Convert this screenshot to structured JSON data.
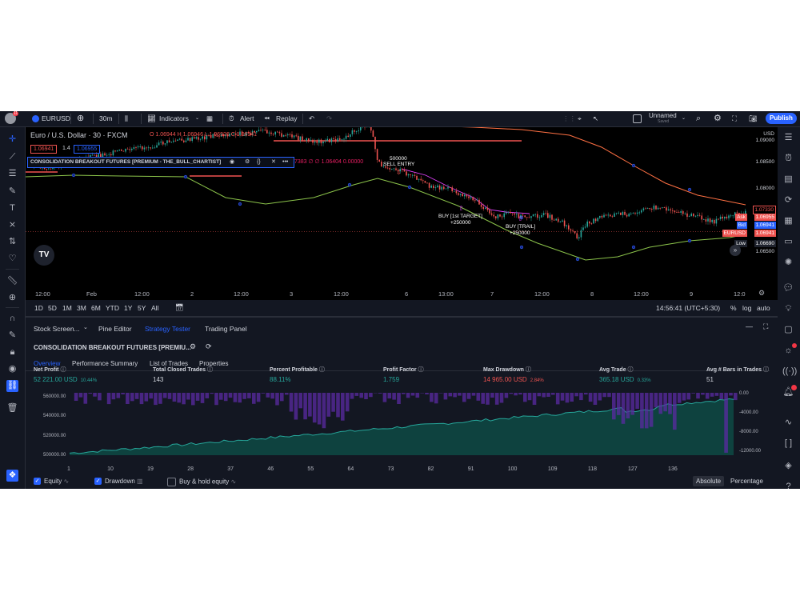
{
  "toolbar": {
    "symbol": "EURUSD",
    "interval": "30m",
    "indicators": "Indicators",
    "alert": "Alert",
    "replay": "Replay",
    "layout_name": "Unnamed",
    "layout_status": "Saved",
    "publish": "Publish",
    "avatar_badge": "11"
  },
  "legend": {
    "title": "Euro / U.S. Dollar · 30 · FXCM",
    "ohlc_o": "O 1.06944",
    "ohlc_h": "H 1.06946",
    "ohlc_l": "L 1.06926",
    "ohlc_c": "C 1.06941",
    "bid": "1.06941",
    "spread": "1.4",
    "ask": "1.06955",
    "strategy_name": "CONSOLIDATION BREAKOUT FUTURES [PREMIUM - THE_BULL_CHARTIST]",
    "strategy_values": "7383 ∅ ∅ 1.06404 0.00000"
  },
  "annotations": {
    "sell_qty": "500000",
    "sell_label": "SELL ENTRY",
    "buy1_label": "BUY [1st TARGET]",
    "buy1_qty": "+250000",
    "buy2_label": "BUY [TRAIL]",
    "buy2_qty": "+250000"
  },
  "price_scale": {
    "currency": "USD",
    "levels": [
      "1.09000",
      "1.08500",
      "1.08000",
      "1.07500",
      "1.07000",
      "1.06500"
    ],
    "tag_red_price": "1.07330",
    "ask_label": "Ask",
    "ask_price": "1.06955",
    "bid_label": "Bid",
    "bid_price": "1.06941",
    "sym_label": "EURUSD",
    "sym_price": "1.06941",
    "low_label": "Low",
    "low_price": "1.06690"
  },
  "time_scale": [
    "12:00",
    "Feb",
    "12:00",
    "2",
    "12:00",
    "3",
    "12:00",
    "6",
    "13:00",
    "7",
    "12:00",
    "8",
    "12:00",
    "9",
    "12:0"
  ],
  "ranges": [
    "1D",
    "5D",
    "1M",
    "3M",
    "6M",
    "YTD",
    "1Y",
    "5Y",
    "All"
  ],
  "range_bar": {
    "clock": "14:56:41 (UTC+5:30)",
    "pct": "%",
    "log": "log",
    "auto": "auto"
  },
  "panel_tabs": [
    "Stock Screen...",
    "Pine Editor",
    "Strategy Tester",
    "Trading Panel"
  ],
  "strategy_short": "CONSOLIDATION BREAKOUT FUTURES [PREMIU...",
  "sub_tabs": [
    "Overview",
    "Performance Summary",
    "List of Trades",
    "Properties"
  ],
  "stats": [
    {
      "label": "Net Profit",
      "value": "52 221.00 USD",
      "extra": "10.44%",
      "color": "#26a69a"
    },
    {
      "label": "Total Closed Trades",
      "value": "143",
      "extra": "",
      "color": "#d1d4dc"
    },
    {
      "label": "Percent Profitable",
      "value": "88.11%",
      "extra": "",
      "color": "#26a69a"
    },
    {
      "label": "Profit Factor",
      "value": "1.759",
      "extra": "",
      "color": "#26a69a"
    },
    {
      "label": "Max Drawdown",
      "value": "14 965.00 USD",
      "extra": "2.84%",
      "color": "#ef5350"
    },
    {
      "label": "Avg Trade",
      "value": "365.18 USD",
      "extra": "0.33%",
      "color": "#26a69a"
    },
    {
      "label": "Avg # Bars in Trades",
      "value": "51",
      "extra": "",
      "color": "#d1d4dc"
    }
  ],
  "chart_data": {
    "type": "area",
    "title": "",
    "x_ticks": [
      1,
      10,
      19,
      28,
      37,
      46,
      55,
      64,
      73,
      82,
      91,
      100,
      109,
      118,
      127,
      136
    ],
    "left_axis": [
      "560000.00",
      "540000.00",
      "520000.00",
      "500000.00"
    ],
    "right_axis": [
      "0.00",
      "-4000.00",
      "-8000.00",
      "-12000.00"
    ],
    "equity_range": [
      500000,
      560000
    ],
    "drawdown_range": [
      0,
      -12000
    ]
  },
  "footer": {
    "equity": "Equity",
    "drawdown": "Drawdown",
    "buyhold": "Buy & hold equity",
    "absolute": "Absolute",
    "percentage": "Percentage"
  },
  "colors": {
    "accent": "#2962ff",
    "up": "#26a69a",
    "down": "#ef5350",
    "drawdown": "#7e57c2"
  }
}
